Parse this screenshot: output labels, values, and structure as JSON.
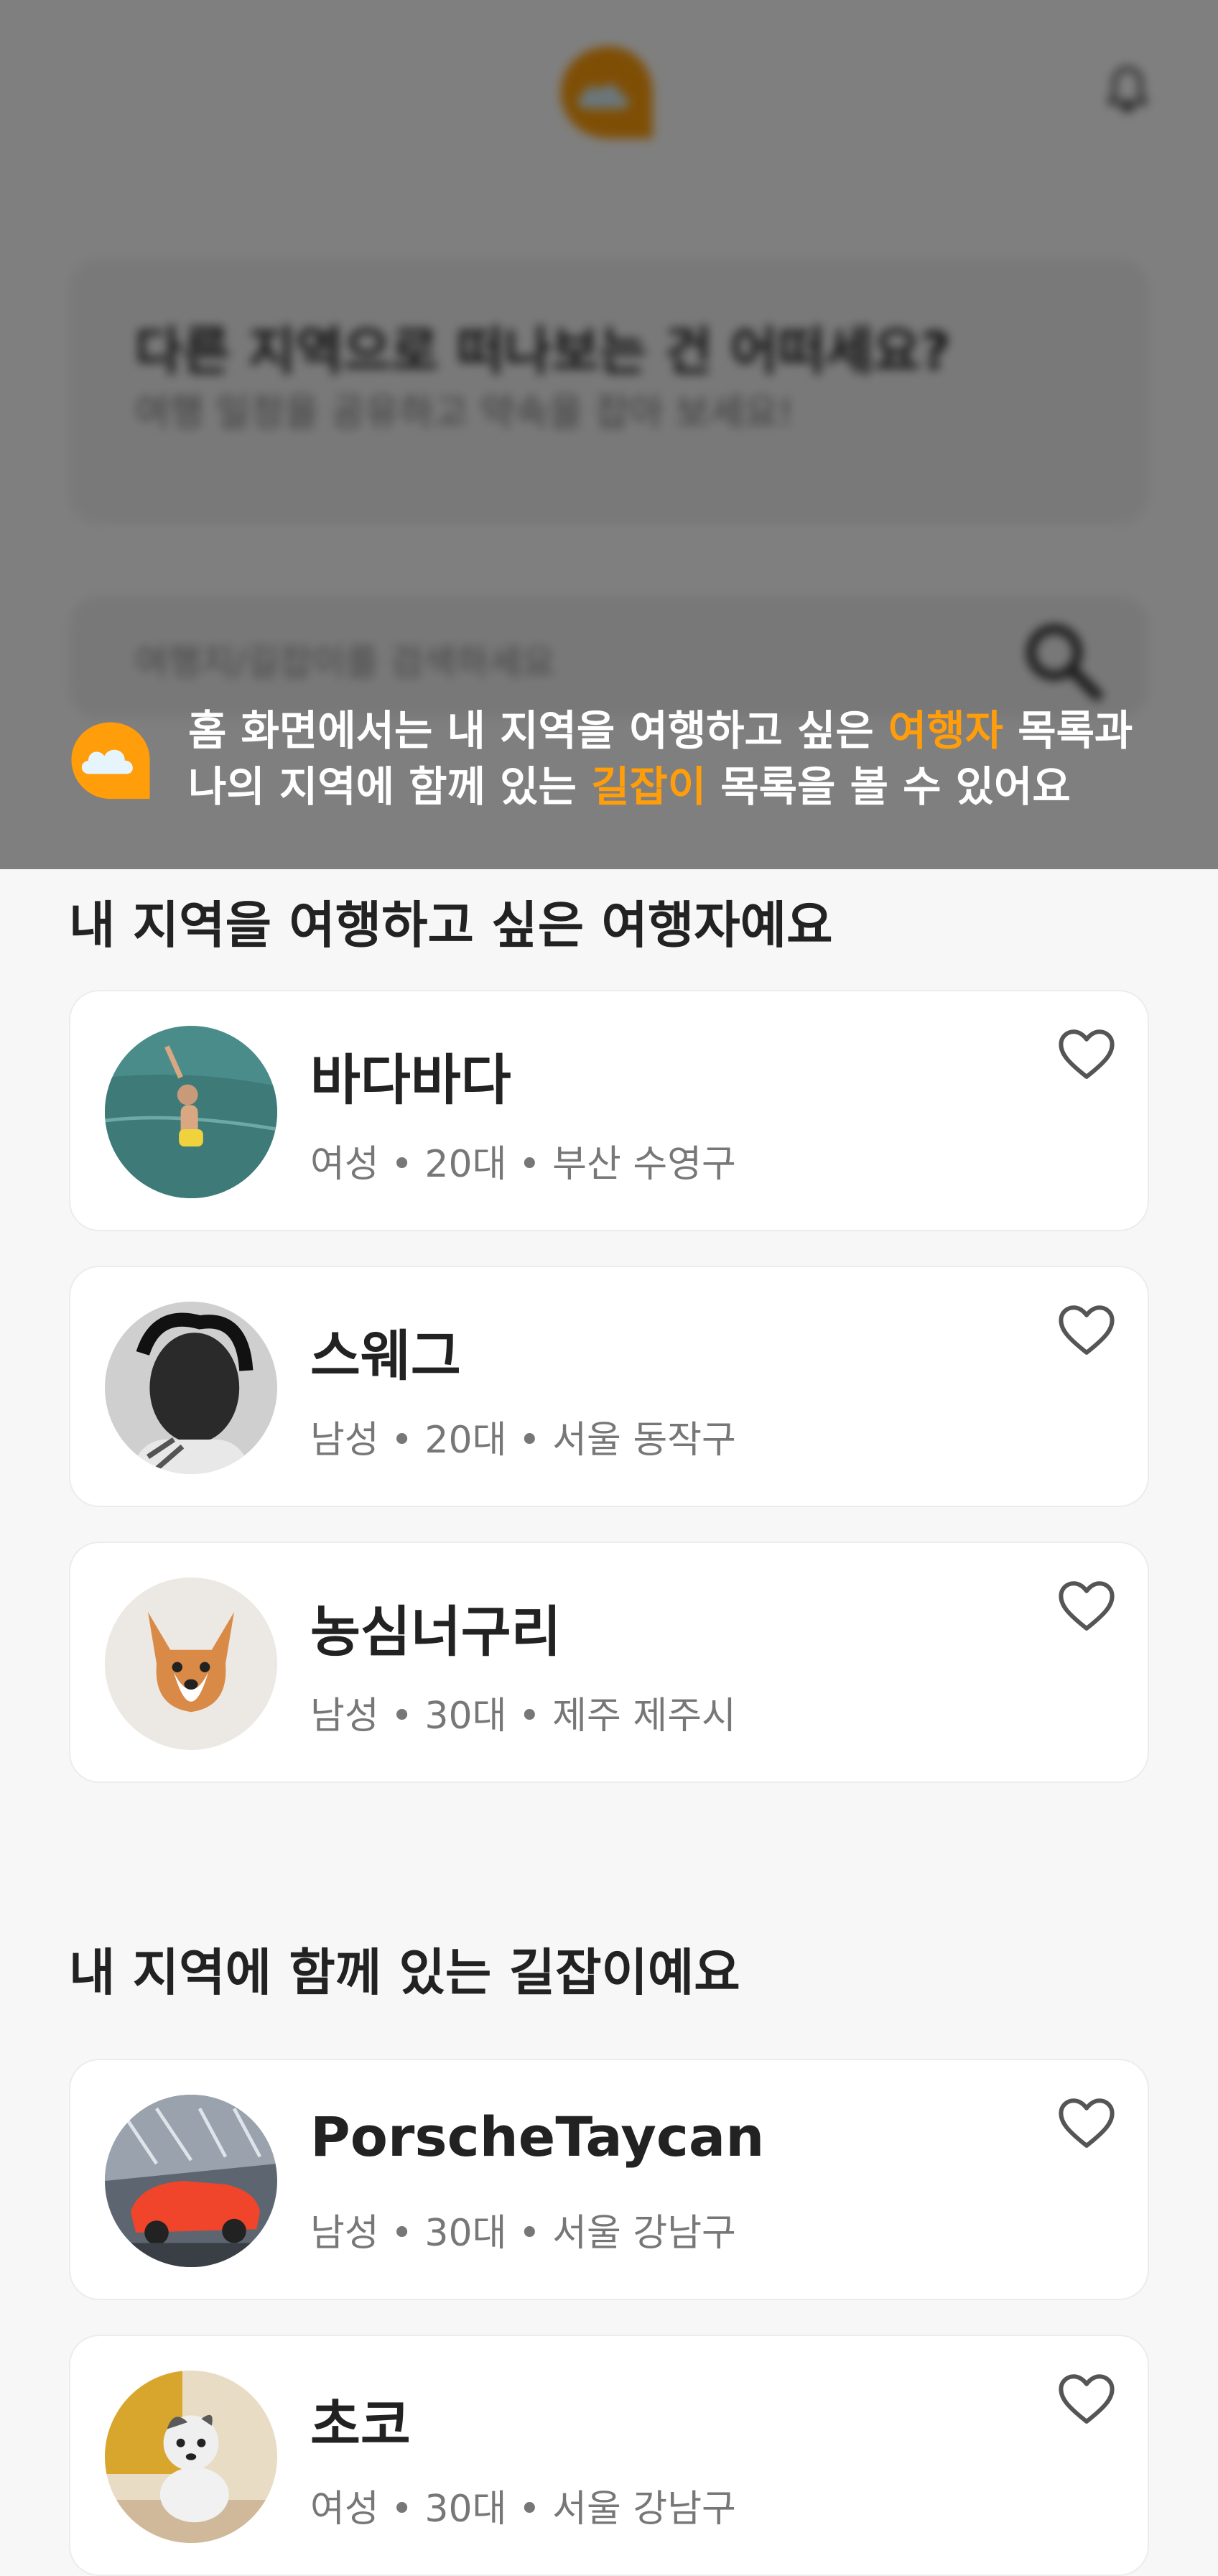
{
  "header": {
    "logo_icon": "cloud-chat-logo-icon",
    "bell_icon": "bell-icon"
  },
  "promo": {
    "title": "다른 지역으로 떠나보는 건 어떠세요?",
    "subtitle": "여행 일정을 공유하고 약속을 잡아 보세요!"
  },
  "search": {
    "placeholder": "여행지/길잡이를 검색하세요",
    "icon": "search-icon"
  },
  "tooltip": {
    "line1_a": "홈 화면에서는 내 지역을 여행하고 싶은 ",
    "line1_highlight": "여행자",
    "line1_b": " 목록과",
    "line2_a": "나의 지역에 함께 있는 ",
    "line2_highlight": "길잡이",
    "line2_b": " 목록을 볼 수 있어요",
    "highlight_color": "#FF9D0A"
  },
  "travelers": {
    "title": "내 지역을 여행하고 싶은 여행자예요",
    "items": [
      {
        "name": "바다바다",
        "meta": "여성 • 20대 • 부산 수영구"
      },
      {
        "name": "스웨그",
        "meta": "남성 • 20대 • 서울 동작구"
      },
      {
        "name": "농심너구리",
        "meta": "남성 • 30대 • 제주 제주시"
      }
    ]
  },
  "guides": {
    "title": "내 지역에 함께 있는 길잡이예요",
    "items": [
      {
        "name": "PorscheTaycan",
        "meta": "남성 • 30대 • 서울 강남구"
      },
      {
        "name": "초코",
        "meta": "여성 • 30대 • 서울 강남구"
      }
    ]
  },
  "colors": {
    "accent": "#FF9D0A",
    "overlay": "rgba(0,0,0,0.5)",
    "background": "#F7F7F7"
  }
}
